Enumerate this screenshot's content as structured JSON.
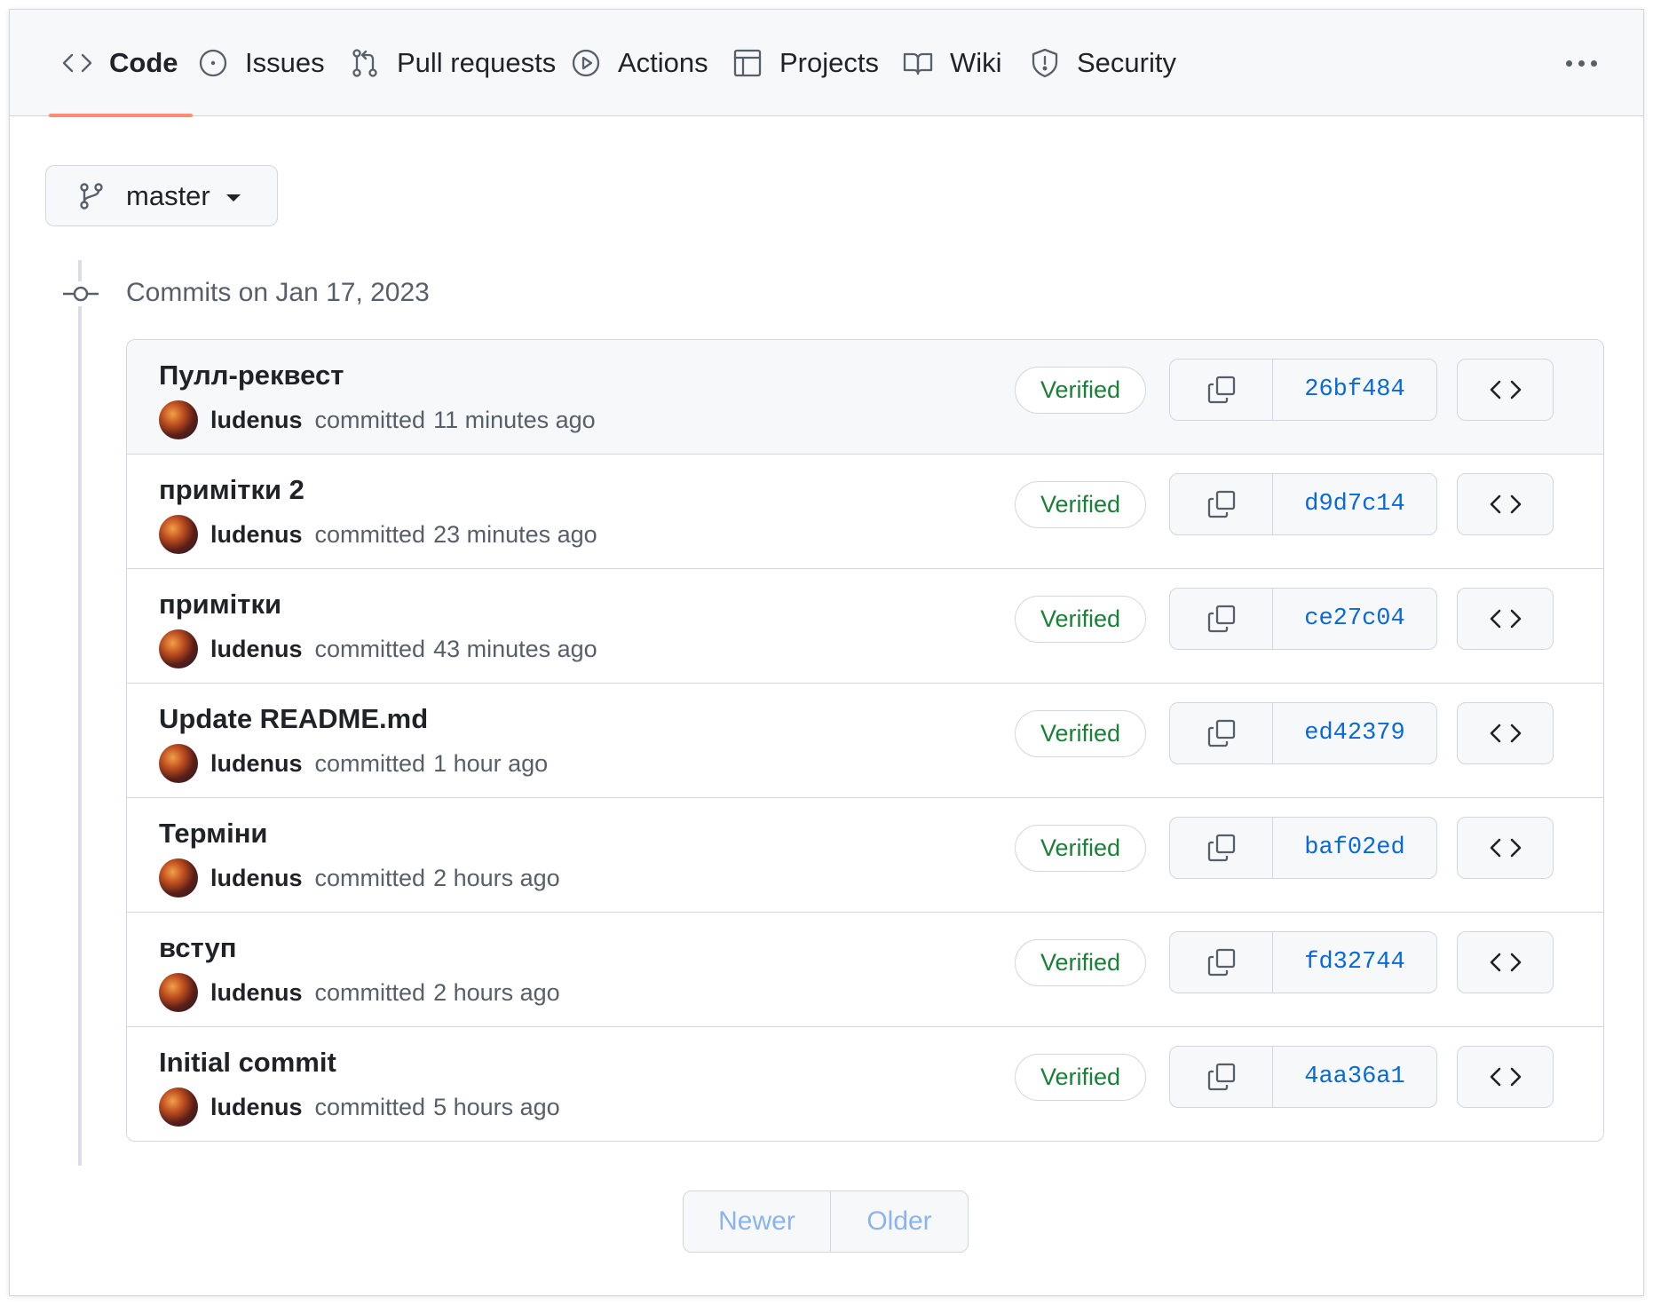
{
  "nav": {
    "tabs": [
      {
        "label": "Code",
        "icon": "code-icon",
        "active": true
      },
      {
        "label": "Issues",
        "icon": "issue-circle-icon",
        "active": false
      },
      {
        "label": "Pull requests",
        "icon": "pull-request-icon",
        "active": false
      },
      {
        "label": "Actions",
        "icon": "play-circle-icon",
        "active": false
      },
      {
        "label": "Projects",
        "icon": "table-icon",
        "active": false
      },
      {
        "label": "Wiki",
        "icon": "book-icon",
        "active": false
      },
      {
        "label": "Security",
        "icon": "shield-icon",
        "active": false
      }
    ],
    "more_icon": "kebab-horizontal-icon"
  },
  "branch": {
    "name": "master",
    "icon": "git-branch-icon"
  },
  "commit_group": {
    "date_heading": "Commits on Jan 17, 2023"
  },
  "commits": [
    {
      "title": "Пулл-реквест",
      "author": "ludenus",
      "action": "committed",
      "time": "11 minutes ago",
      "badge": "Verified",
      "sha": "26bf484"
    },
    {
      "title": "примітки 2",
      "author": "ludenus",
      "action": "committed",
      "time": "23 minutes ago",
      "badge": "Verified",
      "sha": "d9d7c14"
    },
    {
      "title": "примітки",
      "author": "ludenus",
      "action": "committed",
      "time": "43 minutes ago",
      "badge": "Verified",
      "sha": "ce27c04"
    },
    {
      "title": "Update README.md",
      "author": "ludenus",
      "action": "committed",
      "time": "1 hour ago",
      "badge": "Verified",
      "sha": "ed42379"
    },
    {
      "title": "Терміни",
      "author": "ludenus",
      "action": "committed",
      "time": "2 hours ago",
      "badge": "Verified",
      "sha": "baf02ed"
    },
    {
      "title": "вступ",
      "author": "ludenus",
      "action": "committed",
      "time": "2 hours ago",
      "badge": "Verified",
      "sha": "fd32744"
    },
    {
      "title": "Initial commit",
      "author": "ludenus",
      "action": "committed",
      "time": "5 hours ago",
      "badge": "Verified",
      "sha": "4aa36a1"
    }
  ],
  "pagination": {
    "newer": "Newer",
    "older": "Older"
  },
  "colors": {
    "accent_underline": "#fd8c73",
    "verified_green": "#1a7f37",
    "sha_blue": "#0969da",
    "disabled_link": "#8cb4ec"
  }
}
